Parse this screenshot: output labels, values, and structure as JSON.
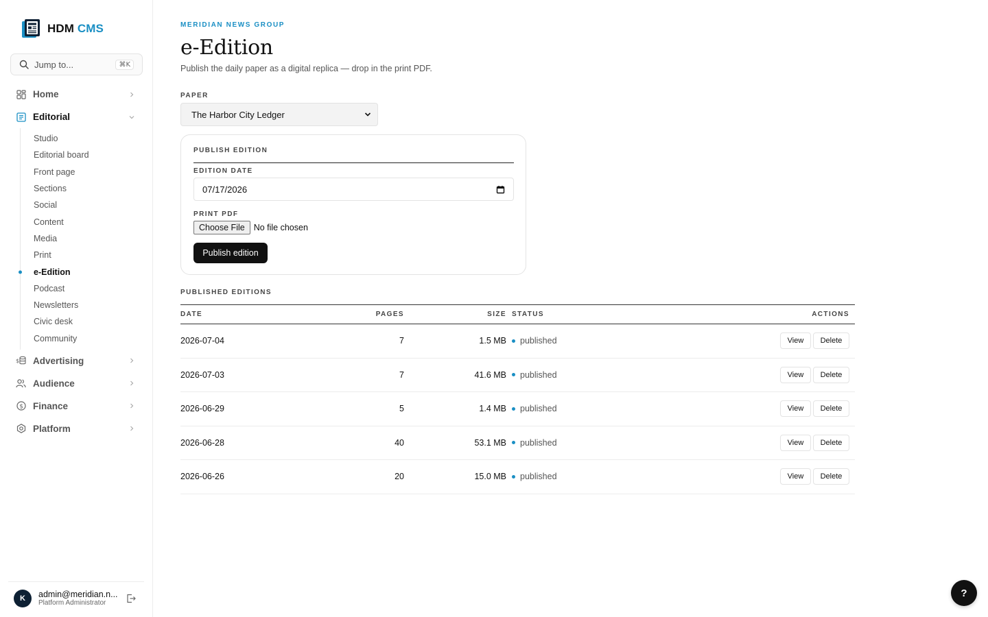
{
  "app": {
    "brand_primary": "HDM",
    "brand_accent": "CMS",
    "accent_color": "#1a8fc4"
  },
  "sidebar": {
    "search": {
      "label": "Jump to...",
      "shortcut": "⌘K"
    },
    "nav": [
      {
        "label": "Home",
        "icon": "grid-icon",
        "expanded": false
      },
      {
        "label": "Editorial",
        "icon": "document-icon",
        "expanded": true
      },
      {
        "label": "Advertising",
        "icon": "coins-icon",
        "expanded": false
      },
      {
        "label": "Audience",
        "icon": "users-icon",
        "expanded": false
      },
      {
        "label": "Finance",
        "icon": "dollar-circle-icon",
        "expanded": false
      },
      {
        "label": "Platform",
        "icon": "hexagon-gear-icon",
        "expanded": false
      }
    ],
    "editorial_items": [
      "Studio",
      "Editorial board",
      "Front page",
      "Sections",
      "Social",
      "Content",
      "Media",
      "Print",
      "e-Edition",
      "Podcast",
      "Newsletters",
      "Civic desk",
      "Community"
    ],
    "current_item": "e-Edition"
  },
  "user": {
    "initial": "K",
    "email": "admin@meridian.n...",
    "role": "Platform Administrator"
  },
  "page": {
    "eyebrow": "MERIDIAN NEWS GROUP",
    "title": "e-Edition",
    "subtitle": "Publish the daily paper as a digital replica — drop in the print PDF."
  },
  "paper": {
    "label": "PAPER",
    "selected": "The Harbor City Ledger"
  },
  "publish_form": {
    "heading": "PUBLISH EDITION",
    "date_label": "EDITION DATE",
    "date_value": "07/17/2026",
    "pdf_label": "PRINT PDF",
    "choose_file": "Choose File",
    "no_file": "No file chosen",
    "submit": "Publish edition"
  },
  "editions": {
    "heading": "PUBLISHED EDITIONS",
    "columns": [
      "DATE",
      "PAGES",
      "SIZE",
      "STATUS",
      "ACTIONS"
    ],
    "rows": [
      {
        "date": "2026-07-04",
        "pages": "7",
        "size": "1.5 MB",
        "status": "published"
      },
      {
        "date": "2026-07-03",
        "pages": "7",
        "size": "41.6 MB",
        "status": "published"
      },
      {
        "date": "2026-06-29",
        "pages": "5",
        "size": "1.4 MB",
        "status": "published"
      },
      {
        "date": "2026-06-28",
        "pages": "40",
        "size": "53.1 MB",
        "status": "published"
      },
      {
        "date": "2026-06-26",
        "pages": "20",
        "size": "15.0 MB",
        "status": "published"
      }
    ],
    "view_label": "View",
    "delete_label": "Delete"
  },
  "help": {
    "label": "?"
  }
}
